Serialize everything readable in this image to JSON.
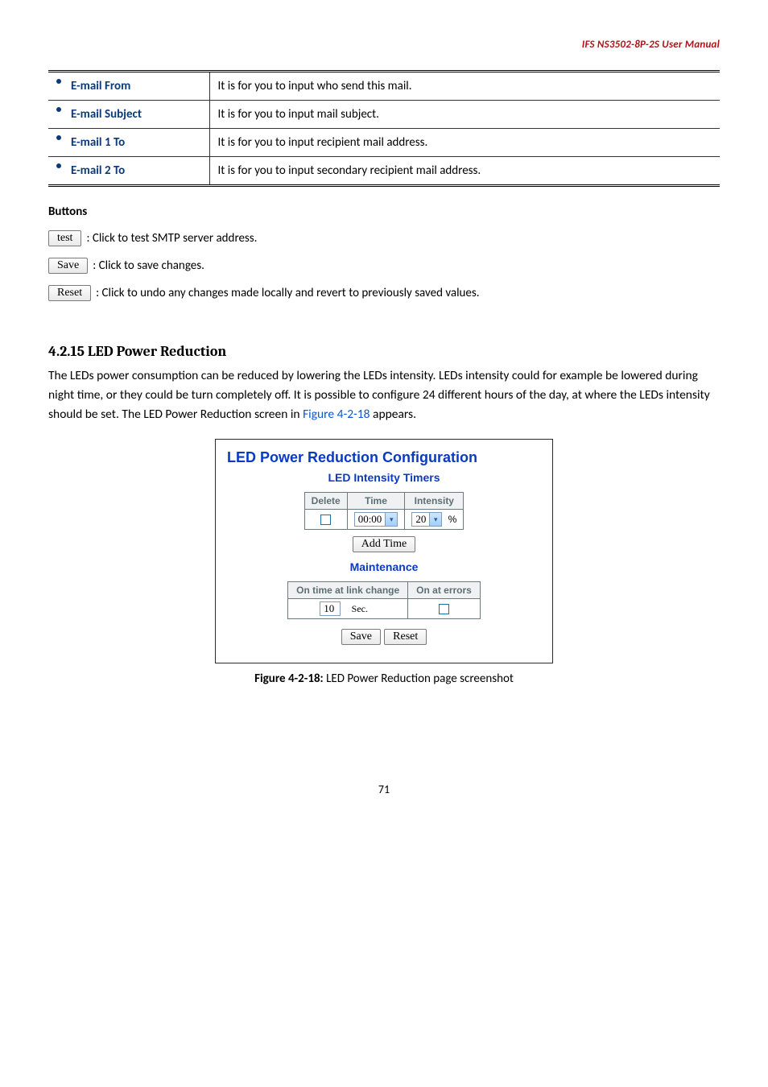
{
  "header": {
    "running_head": "IFS  NS3502-8P-2S  User  Manual"
  },
  "param_table": {
    "rows": [
      {
        "label": "E-mail From",
        "desc": "It is for you to input who send this mail."
      },
      {
        "label": "E-mail Subject",
        "desc": "It is for you to input mail subject."
      },
      {
        "label": "E-mail 1 To",
        "desc": "It is for you to input recipient mail address."
      },
      {
        "label": "E-mail 2 To",
        "desc": "It is for you to input secondary recipient mail address."
      }
    ]
  },
  "buttons_section": {
    "heading": "Buttons",
    "items": [
      {
        "btn": "test",
        "desc": ": Click to test SMTP server address."
      },
      {
        "btn": "Save",
        "desc": ": Click to save changes."
      },
      {
        "btn": "Reset",
        "desc": ": Click to undo any changes made locally and revert to previously saved values."
      }
    ]
  },
  "section": {
    "heading": "4.2.15 LED Power Reduction",
    "body_before": "The LEDs power consumption can be reduced by lowering the LEDs intensity. LEDs intensity could for example be lowered during night time, or they could be turn completely off. It is possible to configure 24 different hours of the day, at where the LEDs intensity should be set. The LED Power Reduction screen in ",
    "fig_ref": "Figure 4-2-18",
    "body_after": " appears."
  },
  "screenshot": {
    "title": "LED Power Reduction Configuration",
    "timers_heading": "LED Intensity Timers",
    "cols": {
      "c1": "Delete",
      "c2": "Time",
      "c3": "Intensity"
    },
    "row": {
      "time": "00:00",
      "intensity": "20",
      "percent": "%"
    },
    "add_btn": "Add Time",
    "maint_heading": "Maintenance",
    "maint_cols": {
      "c1": "On time at link change",
      "c2": "On at errors"
    },
    "maint_row": {
      "val": "10",
      "unit": "Sec."
    },
    "save_btn": "Save",
    "reset_btn": "Reset"
  },
  "caption": {
    "label": "Figure 4-2-18:",
    "text": " LED Power Reduction page screenshot"
  },
  "page_number": "71"
}
